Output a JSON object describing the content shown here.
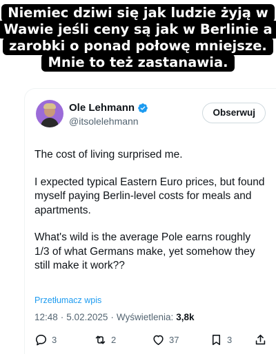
{
  "caption": {
    "lines": [
      "Niemiec dziwi się jak ludzie żyją w",
      "Wawie jeśli ceny są jak w Berlinie a",
      "zarobki o ponad połowę mniejsze.",
      "Mnie to też zastanawia."
    ]
  },
  "tweet": {
    "author_name": "Ole Lehmann",
    "handle": "@itsolelehmann",
    "follow_label": "Obserwuj",
    "paragraphs": [
      "The cost of living surprised me.",
      "I expected typical Eastern Euro prices, but found myself paying Berlin-level costs for meals and apartments.",
      "What's wild is the average Pole earns roughly 1/3 of what Germans make, yet somehow they still make it work??"
    ],
    "translate_label": "Przetłumacz wpis",
    "time": "12:48",
    "date": "5.02.2025",
    "views_label": "Wyświetlenia:",
    "views_count": "3,8k",
    "separator": "·"
  },
  "actions": {
    "replies": "3",
    "reposts": "2",
    "likes": "37",
    "bookmarks": "3"
  },
  "icons": {
    "verified": "verified-badge-icon",
    "reply": "reply-icon",
    "repost": "repost-icon",
    "like": "heart-icon",
    "bookmark": "bookmark-icon",
    "share": "share-icon"
  },
  "colors": {
    "accent": "#1d9bf0",
    "text": "#0f1419",
    "muted": "#536471",
    "caption_bg": "#000000"
  }
}
